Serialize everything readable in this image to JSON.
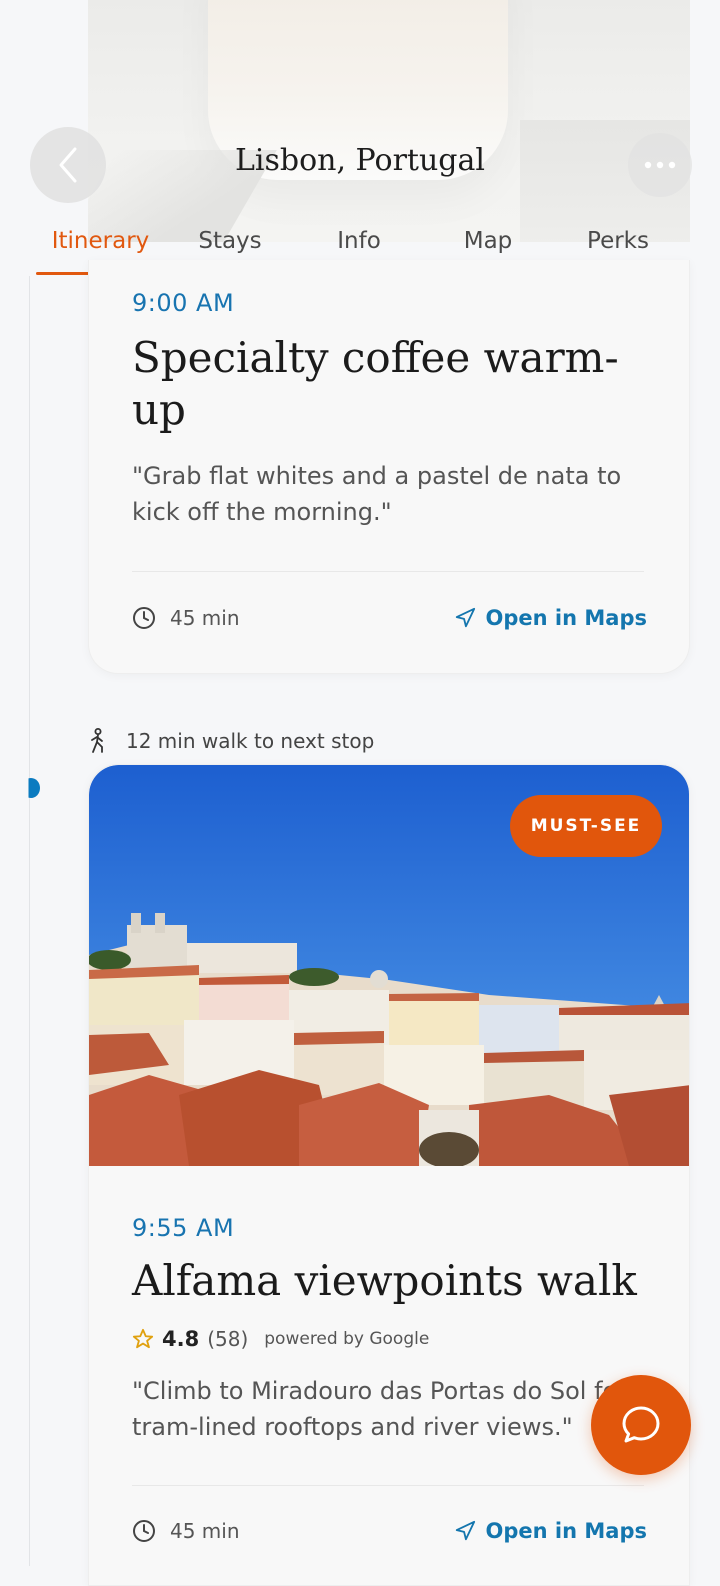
{
  "header": {
    "title": "Lisbon, Portugal",
    "back_icon": "chevron-left-icon",
    "more_icon": "more-horizontal-icon"
  },
  "tabs": [
    {
      "label": "Itinerary",
      "active": true
    },
    {
      "label": "Stays",
      "active": false
    },
    {
      "label": "Info",
      "active": false
    },
    {
      "label": "Map",
      "active": false
    },
    {
      "label": "Perks",
      "active": false
    }
  ],
  "colors": {
    "accent": "#e1580f",
    "link": "#1476ae",
    "time": "#1874b0"
  },
  "stops": [
    {
      "time": "9:00 AM",
      "title": "Specialty coffee warm-up",
      "quote": "\"Grab flat whites and a pastel de nata to kick off the morning.\"",
      "duration": "45 min",
      "maps_label": "Open in Maps"
    },
    {
      "badge": "MUST-SEE",
      "time": "9:55 AM",
      "title": "Alfama viewpoints walk",
      "rating": "4.8",
      "rating_count": "(58)",
      "powered_by": "powered by Google",
      "quote": "\"Climb to Miradouro das Portas do Sol for tram-lined rooftops and river views.\"",
      "duration": "45 min",
      "maps_label": "Open in Maps"
    }
  ],
  "transfer": {
    "text": "12 min walk to next stop",
    "icon": "walking-person-icon"
  },
  "fab": {
    "icon": "chat-bubble-icon"
  }
}
